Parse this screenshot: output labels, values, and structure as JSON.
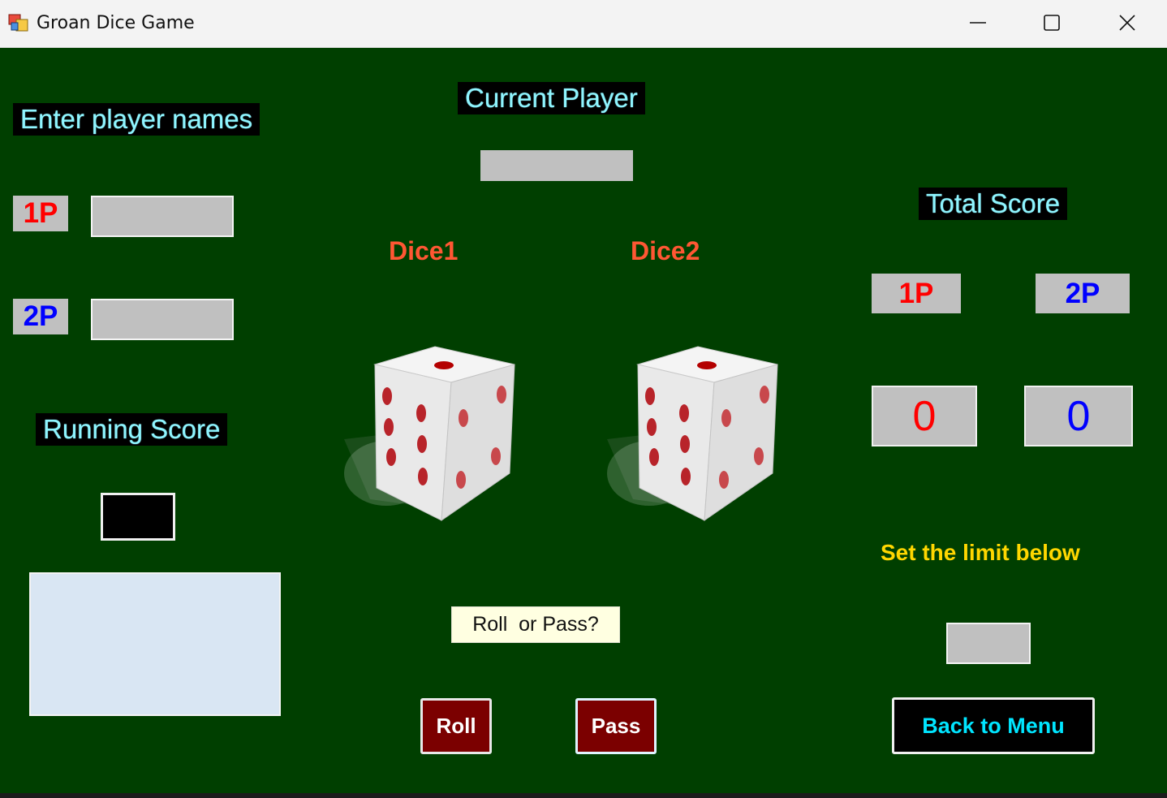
{
  "window": {
    "title": "Groan Dice Game",
    "minimize_icon": "minimize-icon",
    "maximize_icon": "maximize-icon",
    "close_icon": "close-icon"
  },
  "colors": {
    "background": "#003f00",
    "label_text": "#8ff5ff",
    "player1": "#ff0000",
    "player2": "#0000ff",
    "dice_label": "#ff5733",
    "limit_label": "#ffd700",
    "button_bg": "#7b0000"
  },
  "left": {
    "enter_names_label": "Enter player names",
    "p1_tag": "1P",
    "p2_tag": "2P",
    "p1_name_value": "",
    "p2_name_value": "",
    "running_score_label": "Running Score",
    "running_score_value": "",
    "log_value": ""
  },
  "center": {
    "current_player_label": "Current Player",
    "current_player_value": "",
    "dice1_label": "Dice1",
    "dice2_label": "Dice2",
    "dice1_icon": "die-icon",
    "dice2_icon": "die-icon",
    "prompt": "Roll  or Pass?",
    "roll_button": "Roll",
    "pass_button": "Pass"
  },
  "right": {
    "total_score_label": "Total Score",
    "p1_tag": "1P",
    "p2_tag": "2P",
    "p1_score": "0",
    "p2_score": "0",
    "limit_label": "Set the limit below",
    "limit_value": "",
    "back_button": "Back to Menu"
  }
}
